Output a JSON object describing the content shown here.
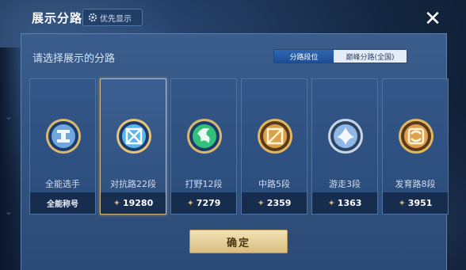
{
  "header": {
    "title": "展示分路",
    "pref_label": "优先显示",
    "close_glyph": "✕"
  },
  "dialog": {
    "subtitle": "请选择展示的分路",
    "tabs": [
      {
        "label": "分路段位",
        "active": true
      },
      {
        "label": "巅峰分路(全国)",
        "active": false
      }
    ],
    "confirm_label": "确定"
  },
  "cards": [
    {
      "label": "全能选手",
      "footer": "全能称号",
      "selected": false,
      "badge": "all-round-badge-icon",
      "color": "#6fa6dd"
    },
    {
      "label": "对抗路22段",
      "score": "19280",
      "selected": true,
      "badge": "clash-lane-badge-icon",
      "color": "#59b6ea"
    },
    {
      "label": "打野12段",
      "score": "7279",
      "selected": false,
      "badge": "jungle-badge-icon",
      "color": "#33c07a"
    },
    {
      "label": "中路5段",
      "score": "2359",
      "selected": false,
      "badge": "mid-lane-badge-icon",
      "color": "#d8a24a"
    },
    {
      "label": "游走3段",
      "score": "1363",
      "selected": false,
      "badge": "roam-badge-icon",
      "color": "#8fb8e6"
    },
    {
      "label": "发育路8段",
      "score": "3951",
      "selected": false,
      "badge": "farm-lane-badge-icon",
      "color": "#e0a050"
    }
  ],
  "colors": {
    "accent": "#d4b67a",
    "tab_active": "#2f67b4",
    "panel": "#335788"
  }
}
